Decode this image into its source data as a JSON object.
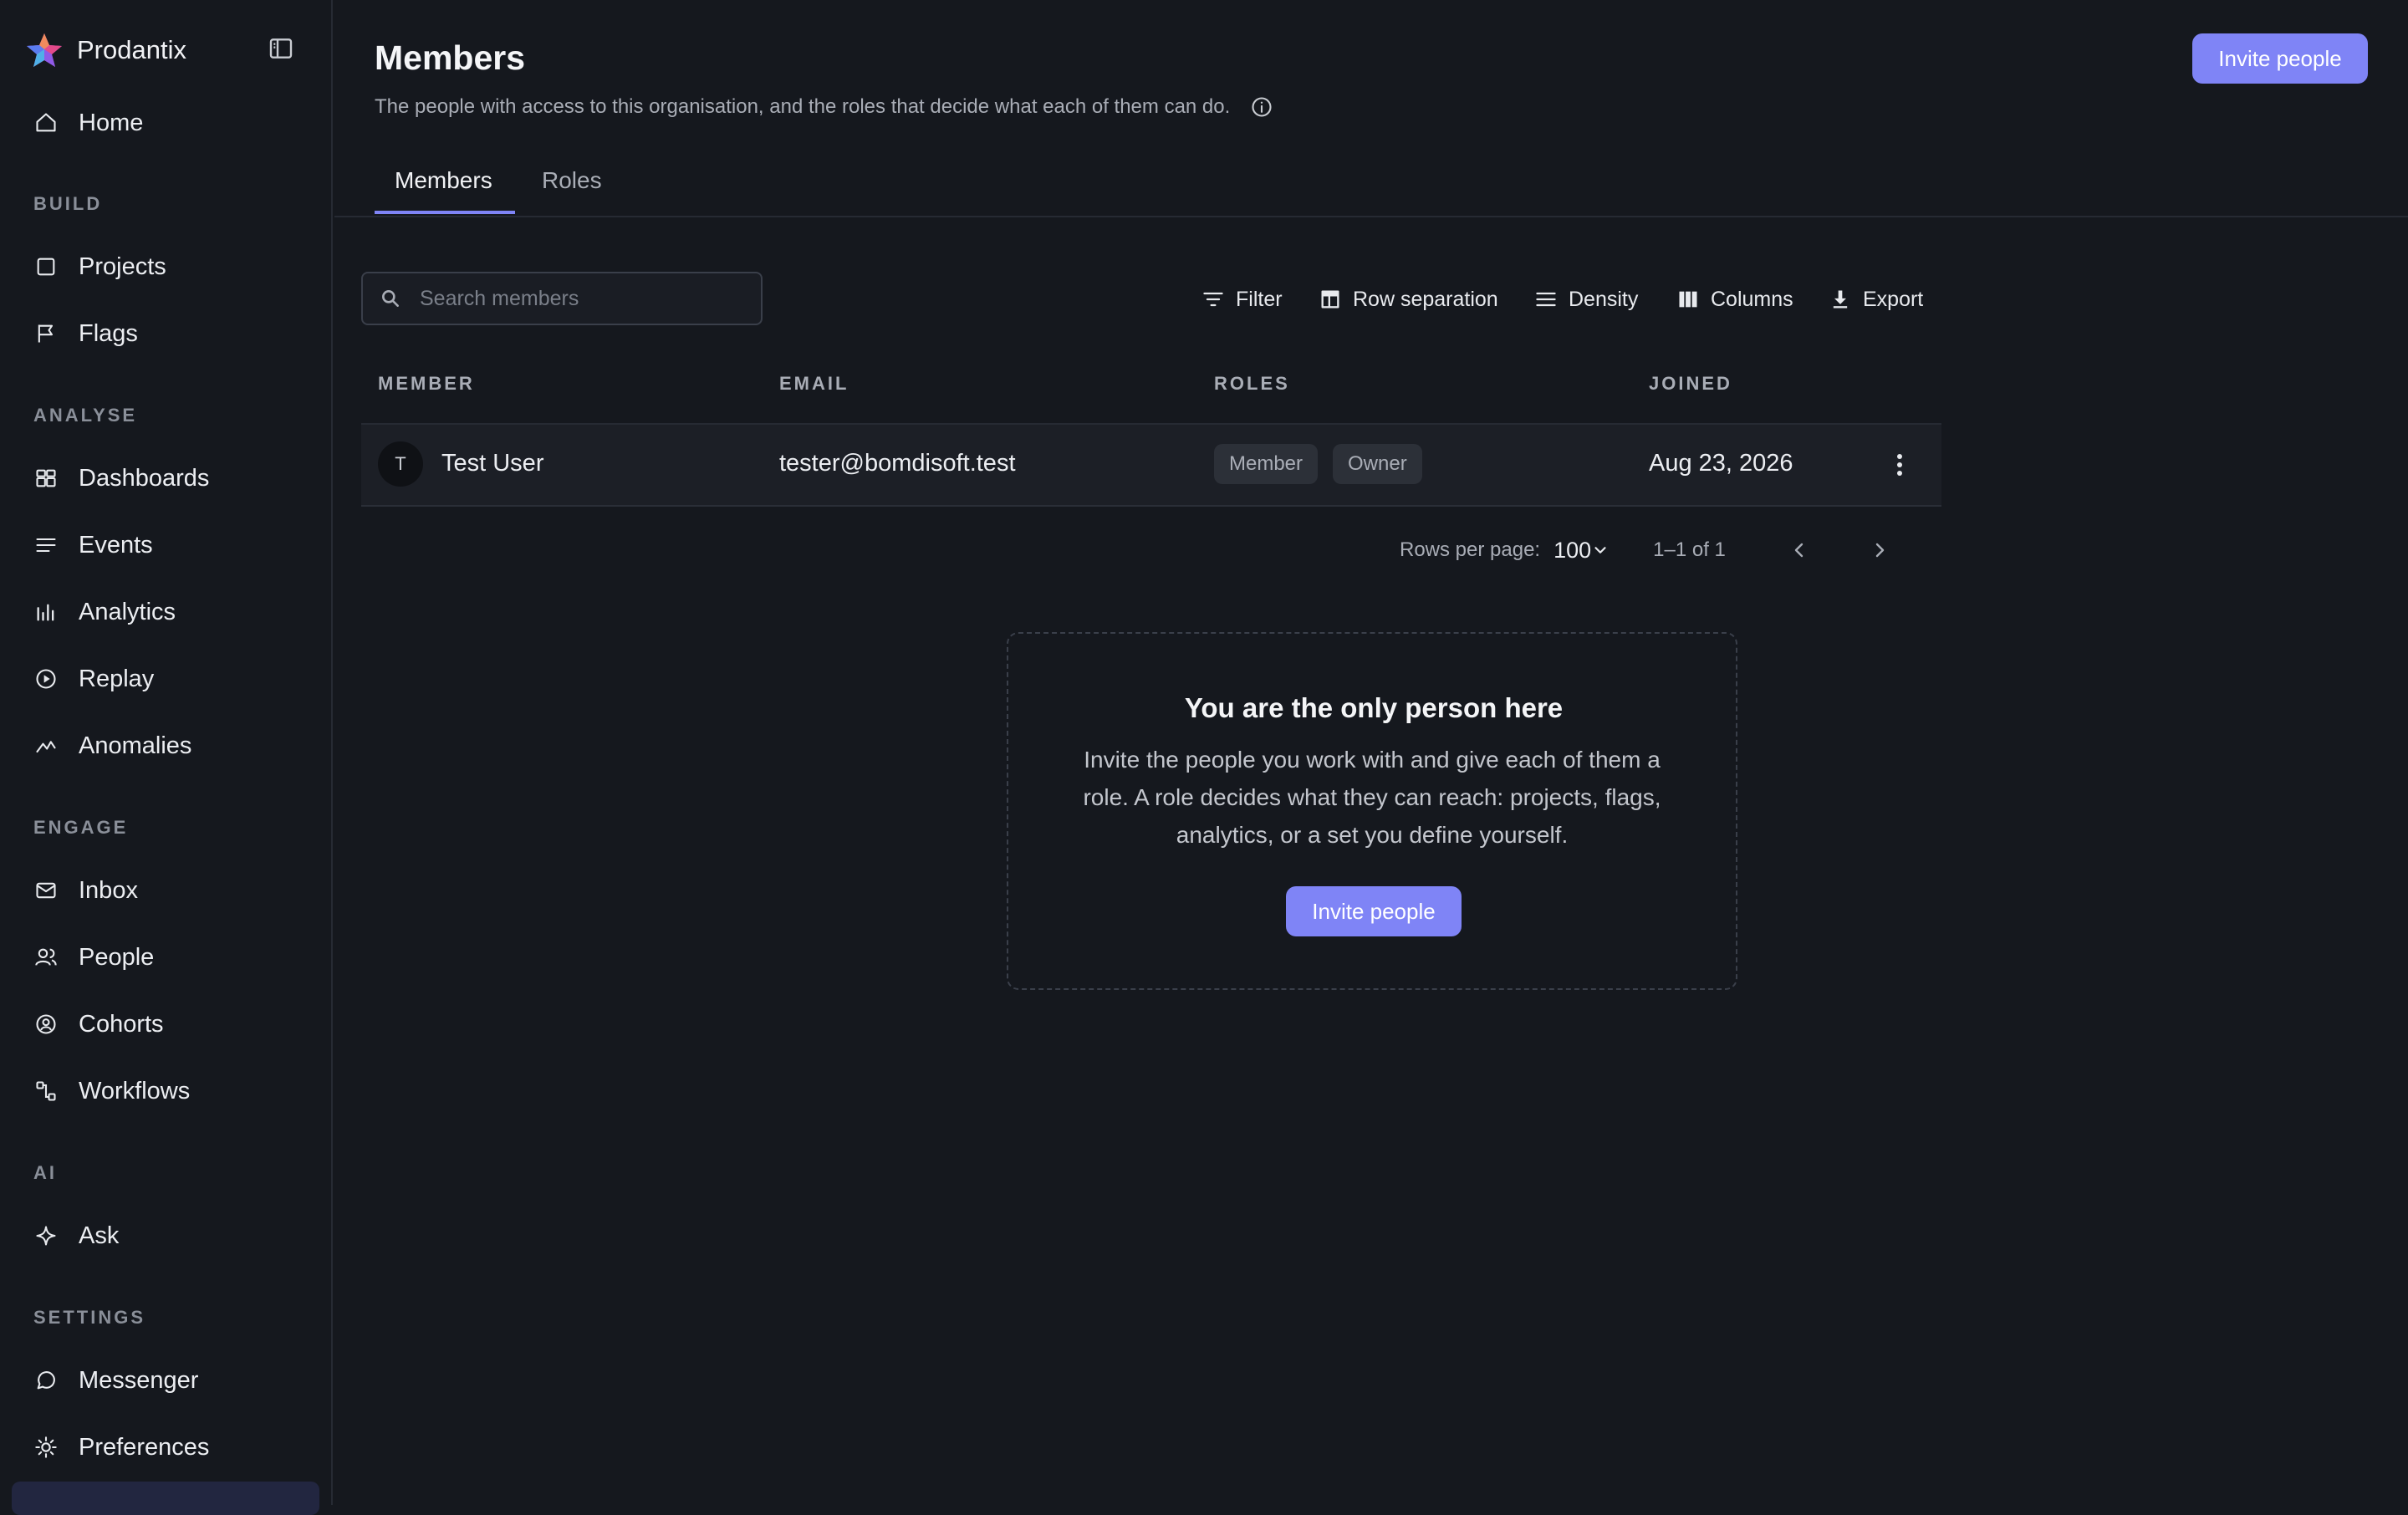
{
  "app": {
    "name": "Prodantix"
  },
  "sidebar": {
    "home": "Home",
    "sections": {
      "build": "BUILD",
      "analyse": "ANALYSE",
      "engage": "ENGAGE",
      "ai": "AI",
      "settings": "SETTINGS"
    },
    "items": {
      "projects": "Projects",
      "flags": "Flags",
      "dashboards": "Dashboards",
      "events": "Events",
      "analytics": "Analytics",
      "replay": "Replay",
      "anomalies": "Anomalies",
      "inbox": "Inbox",
      "people": "People",
      "cohorts": "Cohorts",
      "workflows": "Workflows",
      "ask": "Ask",
      "messenger": "Messenger",
      "preferences": "Preferences"
    }
  },
  "header": {
    "title": "Members",
    "subtitle": "The people with access to this organisation, and the roles that decide what each of them can do.",
    "invite_label": "Invite people"
  },
  "tabs": {
    "members": "Members",
    "roles": "Roles"
  },
  "toolbar": {
    "search_placeholder": "Search members",
    "filter": "Filter",
    "row_separation": "Row separation",
    "density": "Density",
    "columns": "Columns",
    "export": "Export"
  },
  "table": {
    "headers": {
      "member": "MEMBER",
      "email": "EMAIL",
      "roles": "ROLES",
      "joined": "JOINED"
    },
    "rows": [
      {
        "initial": "T",
        "name": "Test User",
        "email": "tester@bomdisoft.test",
        "roles": [
          "Member",
          "Owner"
        ],
        "joined": "Aug 23, 2026"
      }
    ]
  },
  "pagination": {
    "rows_per_page_label": "Rows per page:",
    "rows_per_page_value": "100",
    "range": "1–1 of 1"
  },
  "empty_state": {
    "title": "You are the only person here",
    "body": "Invite the people you work with and give each of them a role. A role decides what they can reach: projects, flags, analytics, or a set you define yourself.",
    "button": "Invite people"
  },
  "colors": {
    "background": "#15181e",
    "accent": "#7f84f6",
    "text": "#e8eaee",
    "muted": "#a9adb6"
  }
}
